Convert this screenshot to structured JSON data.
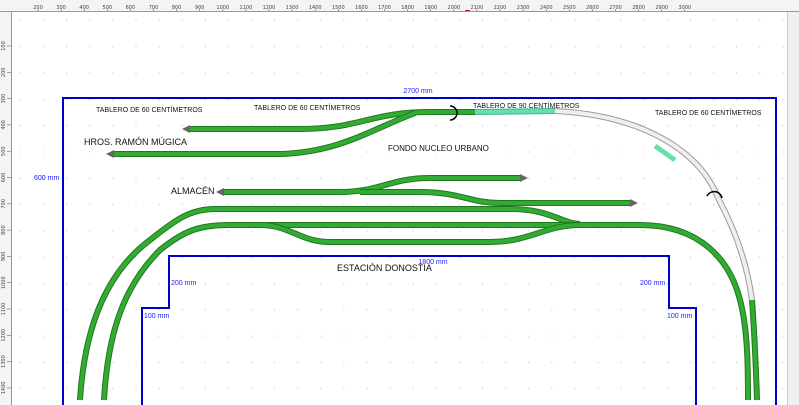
{
  "ruler": {
    "top_ticks": [
      "200",
      "300",
      "400",
      "500",
      "600",
      "700",
      "800",
      "900",
      "1000",
      "1100",
      "1200",
      "1300",
      "1400",
      "1500",
      "1600",
      "1700",
      "1800",
      "1900",
      "2000",
      "2100",
      "2200",
      "2300",
      "2400",
      "2500",
      "2600",
      "2700",
      "2800",
      "2900",
      "3000"
    ],
    "left_ticks": [
      "100",
      "200",
      "300",
      "400",
      "500",
      "600",
      "700",
      "800",
      "900",
      "1000",
      "1100",
      "1200",
      "1300",
      "1400"
    ]
  },
  "labels": {
    "tablero_1": "TABLERO DE 60 CENTÍMETROS",
    "tablero_2": "TABLERO DE 60 CENTÍMETROS",
    "tablero_3": "TABLERO DE 90 CENTÍMETROS",
    "tablero_4": "TABLERO DE 60 CENTÍMETROS",
    "hros": "HROS. RAMÓN MÚGICA",
    "fondo": "FONDO NUCLEO URBANO",
    "almacen": "ALMACÉN",
    "estacion": "ESTACIÓN DONOSTIA"
  },
  "dimensions": {
    "width_top": "2700 mm",
    "height_left": "600 mm",
    "station_width": "1800 mm",
    "step_left": "200 mm",
    "step_right": "200 mm",
    "notch_left": "100 mm",
    "notch_right": "100 mm"
  },
  "colors": {
    "track": "#33aa33",
    "track_dark": "#1e7a1e",
    "track_light": "#66e0aa",
    "track_planned": "#c8c8c8",
    "outline": "#0000cc",
    "grid_dot": "#b8b8c8"
  }
}
